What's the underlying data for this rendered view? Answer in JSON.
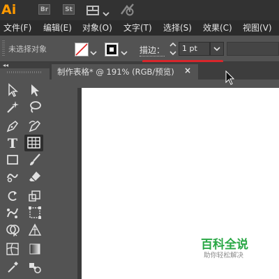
{
  "app": {
    "logo": "Ai",
    "bridge_label": "Br",
    "stock_label": "St"
  },
  "menu": [
    "文件(F)",
    "编辑(E)",
    "对象(O)",
    "文字(T)",
    "选择(S)",
    "效果(C)",
    "视图(V)"
  ],
  "control_bar": {
    "selection_status": "未选择对象",
    "stroke_label": "描边：",
    "stroke_weight": "1 pt"
  },
  "document": {
    "tab_title": "制作表格* @ 191% (RGB/预览)",
    "close_glyph": "×"
  },
  "watermark": {
    "title": "百科全说",
    "subtitle": "助你轻松解决"
  },
  "colors": {
    "app_bar": "#323232",
    "menu_bar": "#2b2b2b",
    "panel": "#535353",
    "logo": "#ff9a00",
    "annotation_underline": "#d9262b",
    "watermark": "#2aa846"
  }
}
